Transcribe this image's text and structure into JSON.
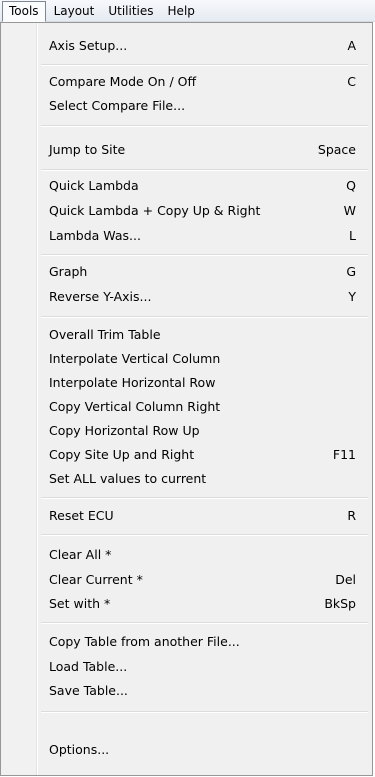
{
  "menubar": {
    "items": [
      {
        "label": "Tools"
      },
      {
        "label": "Layout"
      },
      {
        "label": "Utilities"
      },
      {
        "label": "Help"
      }
    ]
  },
  "menu": {
    "items": [
      {
        "label": "Axis Setup...",
        "shortcut": "A"
      },
      {
        "label": "Compare Mode On / Off",
        "shortcut": "C"
      },
      {
        "label": "Select Compare File...",
        "shortcut": ""
      },
      {
        "label": "Jump to Site",
        "shortcut": "Space"
      },
      {
        "label": "Quick Lambda",
        "shortcut": "Q"
      },
      {
        "label": "Quick Lambda + Copy Up & Right",
        "shortcut": "W"
      },
      {
        "label": "Lambda Was...",
        "shortcut": "L"
      },
      {
        "label": "Graph",
        "shortcut": "G"
      },
      {
        "label": "Reverse Y-Axis...",
        "shortcut": "Y"
      },
      {
        "label": "Overall Trim Table",
        "shortcut": ""
      },
      {
        "label": "Interpolate Vertical Column",
        "shortcut": ""
      },
      {
        "label": "Interpolate Horizontal Row",
        "shortcut": ""
      },
      {
        "label": "Copy Vertical Column Right",
        "shortcut": ""
      },
      {
        "label": "Copy Horizontal Row Up",
        "shortcut": ""
      },
      {
        "label": "Copy Site Up and Right",
        "shortcut": "F11"
      },
      {
        "label": "Set ALL values to current",
        "shortcut": ""
      },
      {
        "label": "Reset ECU",
        "shortcut": "R"
      },
      {
        "label": "Clear All *",
        "shortcut": ""
      },
      {
        "label": "Clear Current *",
        "shortcut": "Del"
      },
      {
        "label": "Set with *",
        "shortcut": "BkSp"
      },
      {
        "label": "Copy Table from another File...",
        "shortcut": ""
      },
      {
        "label": "Load Table...",
        "shortcut": ""
      },
      {
        "label": "Save Table...",
        "shortcut": ""
      },
      {
        "label": "Options...",
        "shortcut": ""
      }
    ]
  }
}
